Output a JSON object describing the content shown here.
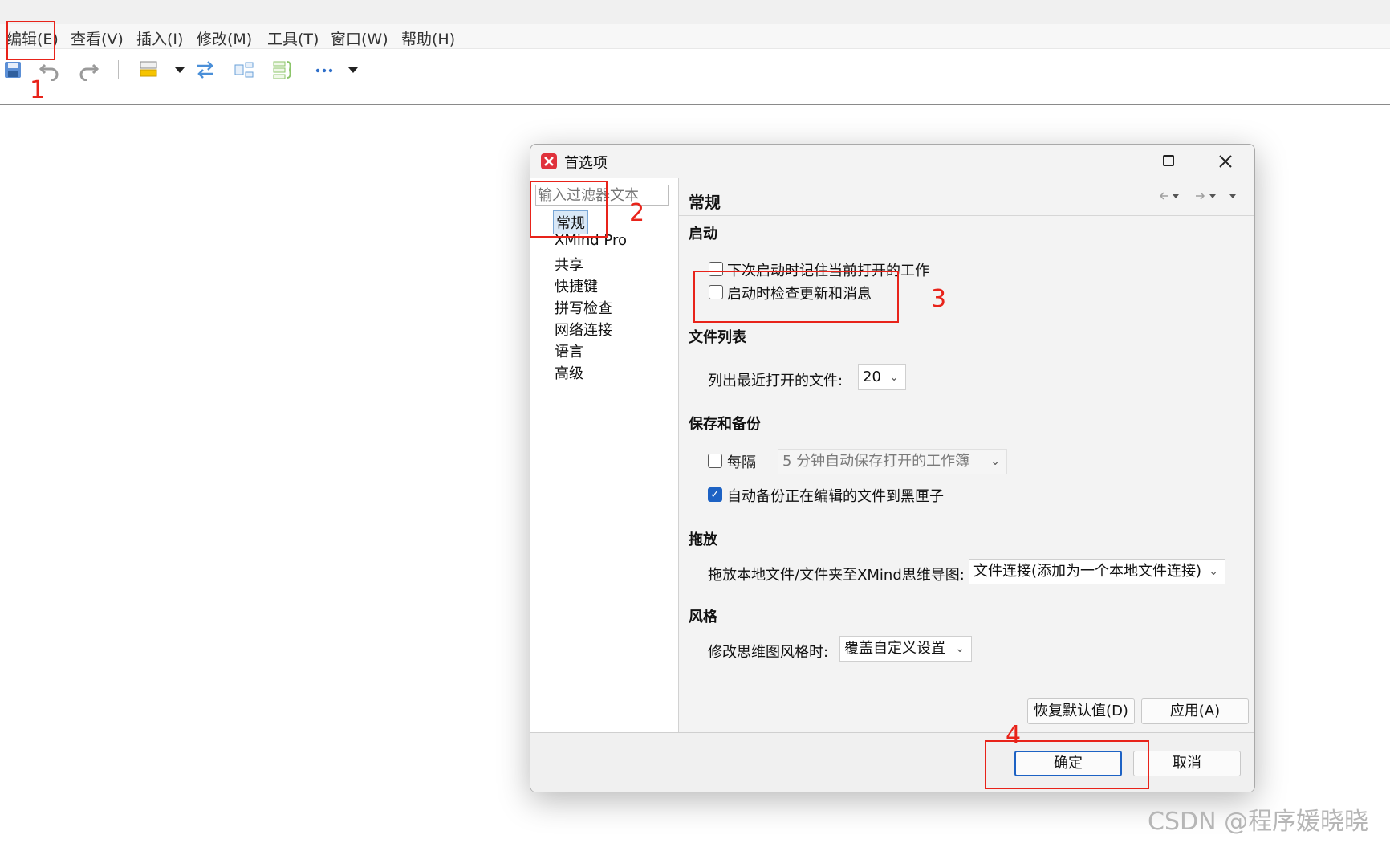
{
  "menubar": {
    "items": [
      "编辑(E)",
      "查看(V)",
      "插入(I)",
      "修改(M)",
      "工具(T)",
      "窗口(W)",
      "帮助(H)"
    ]
  },
  "toolbar": {
    "icons": [
      "save-icon",
      "undo-icon",
      "redo-icon",
      "style-icon",
      "dropdown-icon",
      "relationship-icon",
      "summary-icon",
      "boundary-icon",
      "more-icon",
      "dropdown-icon"
    ]
  },
  "dialog": {
    "title": "首选项",
    "filter_placeholder": "输入过滤器文本",
    "nav": [
      "常规",
      "XMind Pro",
      "共享",
      "快捷键",
      "拼写检查",
      "网络连接",
      "语言",
      "高级"
    ],
    "page_title": "常规",
    "startup": {
      "heading": "启动",
      "remember_label": "下次启动时记住当前打开的工作",
      "check_updates_label": "启动时检查更新和消息"
    },
    "filelist": {
      "heading": "文件列表",
      "recent_label": "列出最近打开的文件:",
      "recent_value": "20"
    },
    "backup": {
      "heading": "保存和备份",
      "every_label": "每隔",
      "autosave_value": "5  分钟自动保存打开的工作簿",
      "autobackup_label": "自动备份正在编辑的文件到黑匣子",
      "autobackup_checked": true
    },
    "dragdrop": {
      "heading": "拖放",
      "label": "拖放本地文件/文件夹至XMind思维导图:",
      "value": "文件连接(添加为一个本地文件连接)"
    },
    "style": {
      "heading": "风格",
      "label": "修改思维图风格时:",
      "value": "覆盖自定义设置"
    },
    "restore_defaults": "恢复默认值(D)",
    "apply": "应用(A)",
    "ok": "确定",
    "cancel": "取消"
  },
  "annotations": [
    "1",
    "2",
    "3",
    "4"
  ],
  "watermark": "CSDN @程序媛晓晓",
  "colors": {
    "annotation_red": "#e8231a",
    "accent_blue": "#1d62c4"
  }
}
